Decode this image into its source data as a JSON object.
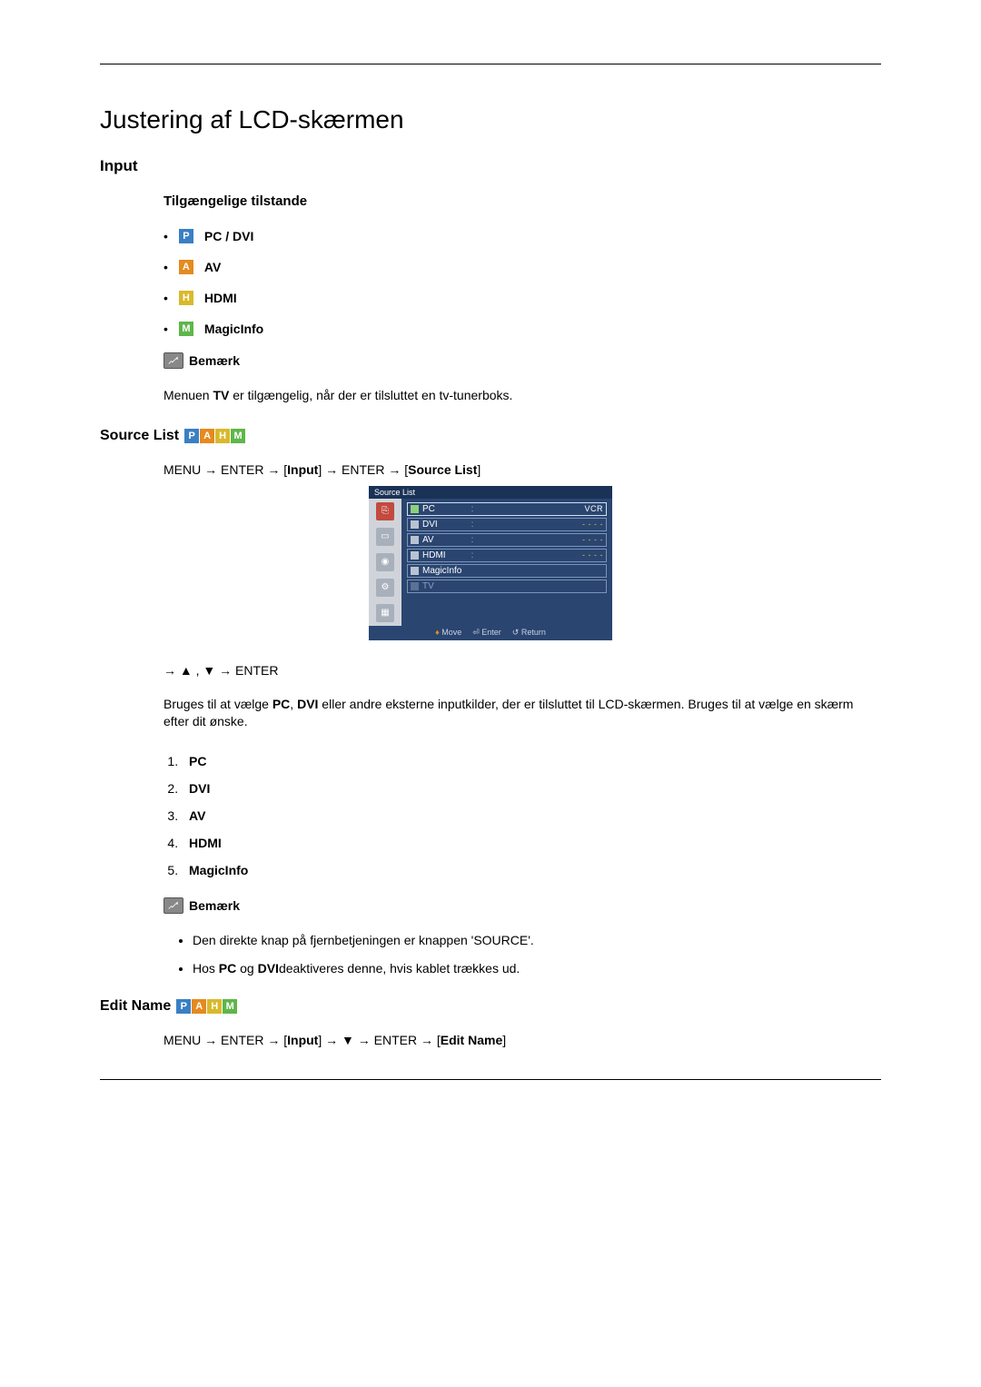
{
  "page": {
    "title": "Justering af LCD-skærmen"
  },
  "input_section": {
    "heading": "Input",
    "modes_heading": "Tilgængelige tilstande",
    "modes": {
      "pc_dvi": {
        "icon": "P",
        "label": "PC / DVI"
      },
      "av": {
        "icon": "A",
        "label": "AV"
      },
      "hdmi": {
        "icon": "H",
        "label": "HDMI"
      },
      "magic": {
        "icon": "M",
        "label": "MagicInfo"
      }
    },
    "note_label": "Bemærk",
    "note_text_prefix": "Menuen ",
    "note_text_bold": "TV",
    "note_text_suffix": " er tilgængelig, når der er tilsluttet en tv-tunerboks."
  },
  "source_list": {
    "heading": "Source List",
    "menu_path": {
      "p1": "MENU → ENTER → [",
      "b1": "Input",
      "p2": "] → ENTER → [",
      "b2": "Source List",
      "p3": "]"
    },
    "osd": {
      "title": "Source List",
      "rows": [
        {
          "label": "PC",
          "value": "VCR",
          "active": true,
          "checked": true
        },
        {
          "label": "DVI",
          "value": "- - - -",
          "active": false,
          "checked": false
        },
        {
          "label": "AV",
          "value": "- - - -",
          "active": false,
          "checked": false
        },
        {
          "label": "HDMI",
          "value": "- - - -",
          "active": false,
          "checked": false
        },
        {
          "label": "MagicInfo",
          "value": "",
          "active": false,
          "checked": false
        },
        {
          "label": "TV",
          "value": "",
          "active": false,
          "checked": false,
          "faded": true
        }
      ],
      "footer": {
        "move": "Move",
        "enter": "Enter",
        "return": "Return"
      }
    },
    "nav_line": "→ ▲ , ▼ → ENTER",
    "desc_p1": "Bruges til at vælge ",
    "desc_b1": "PC",
    "desc_p2": ", ",
    "desc_b2": "DVI",
    "desc_p3": " eller andre eksterne inputkilder, der er tilsluttet til LCD-skærmen. Bruges til at vælge en skærm efter dit ønske.",
    "items": [
      "PC",
      "DVI",
      "AV",
      "HDMI",
      "MagicInfo"
    ],
    "note_label": "Bemærk",
    "notes": {
      "n1": "Den direkte knap på fjernbetjeningen er knappen 'SOURCE'.",
      "n2_p1": "Hos ",
      "n2_b1": "PC",
      "n2_p2": " og ",
      "n2_b2": "DVI",
      "n2_p3": "deaktiveres denne, hvis kablet trækkes ud."
    }
  },
  "edit_name": {
    "heading": "Edit Name",
    "menu_path": {
      "p1": "MENU → ENTER → [",
      "b1": "Input",
      "p2": "] → ▼ → ENTER → [",
      "b2": "Edit Name",
      "p3": "]"
    }
  },
  "icons": {
    "P": "P",
    "A": "A",
    "H": "H",
    "M": "M"
  }
}
